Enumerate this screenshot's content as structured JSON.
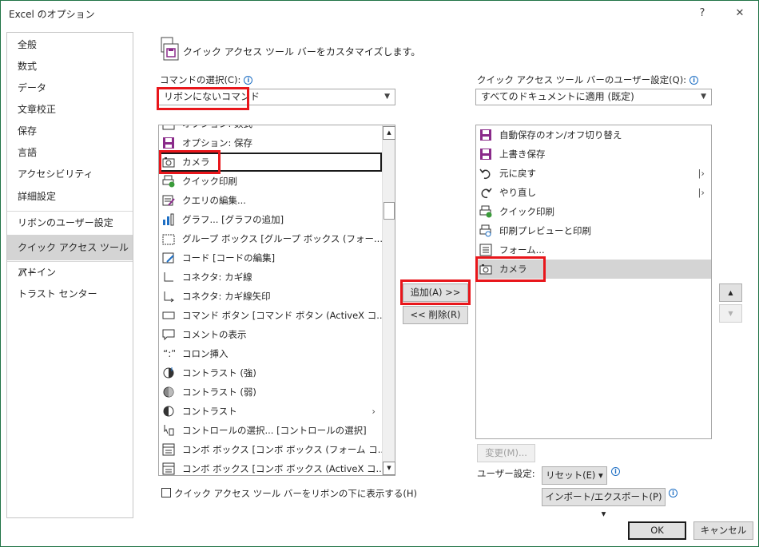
{
  "window": {
    "title": "Excel のオプション",
    "help": "?",
    "close": "✕"
  },
  "nav": [
    {
      "label": "全般"
    },
    {
      "label": "数式"
    },
    {
      "label": "データ"
    },
    {
      "label": "文章校正"
    },
    {
      "label": "保存"
    },
    {
      "label": "言語"
    },
    {
      "label": "アクセシビリティ"
    },
    {
      "label": "詳細設定"
    },
    {
      "label": "リボンのユーザー設定"
    },
    {
      "label": "クイック アクセス ツール バー"
    },
    {
      "label": "アドイン"
    },
    {
      "label": "トラスト センター"
    }
  ],
  "heading": "クイック アクセス ツール バーをカスタマイズします。",
  "left": {
    "label": "コマンドの選択(C):",
    "dropdown_value": "リボンにないコマンド",
    "items": [
      {
        "label": "オプション: 数式",
        "icon": "options-icon"
      },
      {
        "label": "オプション: 保存",
        "icon": "save-icon"
      },
      {
        "label": "カメラ",
        "icon": "camera-icon"
      },
      {
        "label": "クイック印刷",
        "icon": "quick-print-icon"
      },
      {
        "label": "クエリの編集...",
        "icon": "query-edit-icon"
      },
      {
        "label": "グラフ... [グラフの追加]",
        "icon": "chart-icon"
      },
      {
        "label": "グループ ボックス [グループ ボックス (フォー...",
        "icon": "group-box-icon"
      },
      {
        "label": "コード [コードの編集]",
        "icon": "code-icon"
      },
      {
        "label": "コネクタ: カギ線",
        "icon": "connector-icon"
      },
      {
        "label": "コネクタ: カギ線矢印",
        "icon": "connector-arrow-icon"
      },
      {
        "label": "コマンド ボタン [コマンド ボタン (ActiveX コ...",
        "icon": "command-button-icon"
      },
      {
        "label": "コメントの表示",
        "icon": "comment-icon"
      },
      {
        "label": "コロン挿入",
        "icon": "colon-icon"
      },
      {
        "label": "コントラスト (強)",
        "icon": "contrast-more-icon"
      },
      {
        "label": "コントラスト (弱)",
        "icon": "contrast-less-icon"
      },
      {
        "label": "コントラスト",
        "icon": "contrast-icon",
        "submenu": "›"
      },
      {
        "label": "コントロールの選択... [コントロールの選択]",
        "icon": "select-controls-icon"
      },
      {
        "label": "コンボ ボックス [コンボ ボックス (フォーム コ...",
        "icon": "combo-box-icon"
      },
      {
        "label": "コンボ ボックス [コンボ ボックス (ActiveX コ...",
        "icon": "combo-box-activex-icon"
      }
    ]
  },
  "right": {
    "label": "クイック アクセス ツール バーのユーザー設定(Q):",
    "dropdown_value": "すべてのドキュメントに適用 (既定)",
    "items": [
      {
        "label": "自動保存のオン/オフ切り替え",
        "icon": "autosave-icon"
      },
      {
        "label": "上書き保存",
        "icon": "save-icon"
      },
      {
        "label": "元に戻す",
        "icon": "undo-icon",
        "submenu": "|›"
      },
      {
        "label": "やり直し",
        "icon": "redo-icon",
        "submenu": "|›"
      },
      {
        "label": "クイック印刷",
        "icon": "quick-print-icon"
      },
      {
        "label": "印刷プレビューと印刷",
        "icon": "print-preview-icon"
      },
      {
        "label": "フォーム...",
        "icon": "form-icon"
      },
      {
        "label": "カメラ",
        "icon": "camera-icon"
      }
    ]
  },
  "buttons": {
    "add": "追加(A) >>",
    "remove": "<< 削除(R)",
    "modify": "変更(M)...",
    "reset": "リセット(E) ▾",
    "import_export": "インポート/エクスポート(P) ▾",
    "ok": "OK",
    "cancel": "キャンセル",
    "move_up": "▲",
    "move_down": "▼"
  },
  "user_settings_label": "ユーザー設定:",
  "checkbox_label": "クイック アクセス ツール バーをリボンの下に表示する(H)",
  "colors": {
    "highlight": "#e8161b",
    "selected": "#d4d4d4",
    "accent": "#8a2a8a"
  }
}
